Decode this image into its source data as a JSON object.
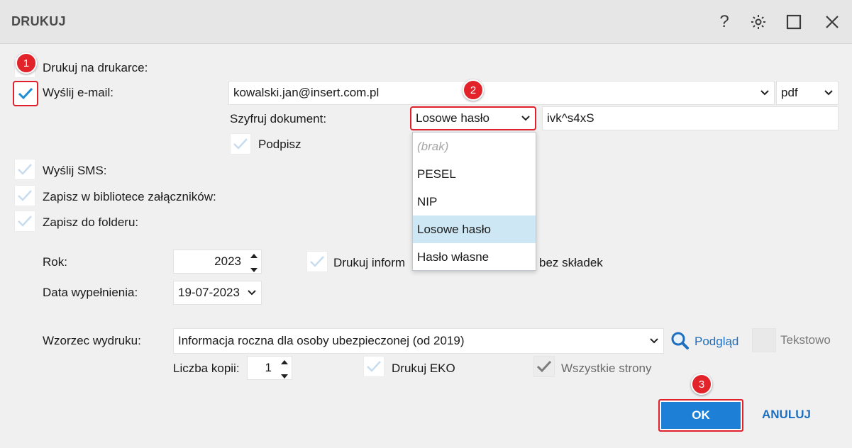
{
  "window": {
    "title": "DRUKUJ",
    "help_icon": "?"
  },
  "options": {
    "print_on_printer": "Drukuj na drukarce:",
    "send_email": "Wyślij e-mail:",
    "send_sms": "Wyślij SMS:",
    "save_library": "Zapisz w bibliotece załączników:",
    "save_folder": "Zapisz do folderu:"
  },
  "email": {
    "address": "kowalski.jan@insert.com.pl",
    "format": "pdf",
    "encrypt_label": "Szyfruj dokument:",
    "encrypt_value": "Losowe hasło",
    "password": "ivk^s4xS",
    "sign_label": "Podpisz"
  },
  "encrypt_options": [
    "(brak)",
    "PESEL",
    "NIP",
    "Losowe hasło",
    "Hasło własne"
  ],
  "form": {
    "year_label": "Rok:",
    "year_value": "2023",
    "date_label": "Data wypełnienia:",
    "date_value": "19-07-2023",
    "print_info_label_start": "Drukuj inform",
    "print_info_label_end": "bez składek",
    "template_label": "Wzorzec wydruku:",
    "template_value": "Informacja roczna dla osoby ubezpieczonej (od 2019)",
    "preview_label": "Podgląd",
    "text_label": "Tekstowo",
    "copies_label": "Liczba kopii:",
    "copies_value": "1",
    "eco_label": "Drukuj EKO",
    "all_pages_label": "Wszystkie strony"
  },
  "badges": {
    "b1": "1",
    "b2": "2",
    "b3": "3"
  },
  "buttons": {
    "ok": "OK",
    "cancel": "ANULUJ"
  },
  "colors": {
    "accent": "#1e7fd6",
    "badge": "#e2232a",
    "link": "#1e6fbf"
  }
}
